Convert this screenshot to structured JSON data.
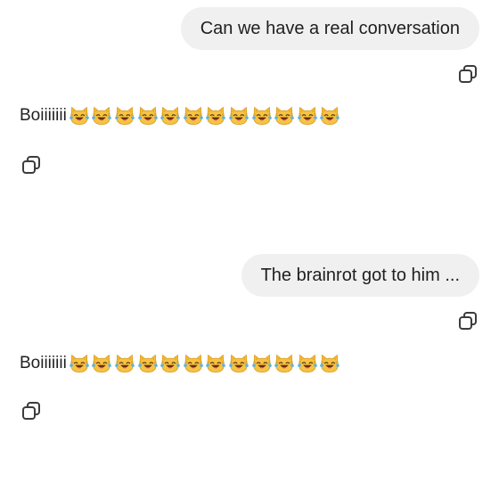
{
  "conversation": {
    "messages": [
      {
        "role": "user",
        "text": "Can we have a real conversation"
      },
      {
        "role": "assistant",
        "text": "Boiiiiiii",
        "emoji": "cat-with-tears-of-joy",
        "emoji_count": 12
      },
      {
        "role": "user",
        "text": "The brainrot got to him ..."
      },
      {
        "role": "assistant",
        "text": "Boiiiiiii",
        "emoji": "cat-with-tears-of-joy",
        "emoji_count": 12
      }
    ]
  },
  "icons": {
    "copy": "copy-icon"
  },
  "colors": {
    "background": "#ffffff",
    "user_bubble": "#f0f0f0",
    "text": "#1f1f1f",
    "icon": "#3c3c3c"
  }
}
